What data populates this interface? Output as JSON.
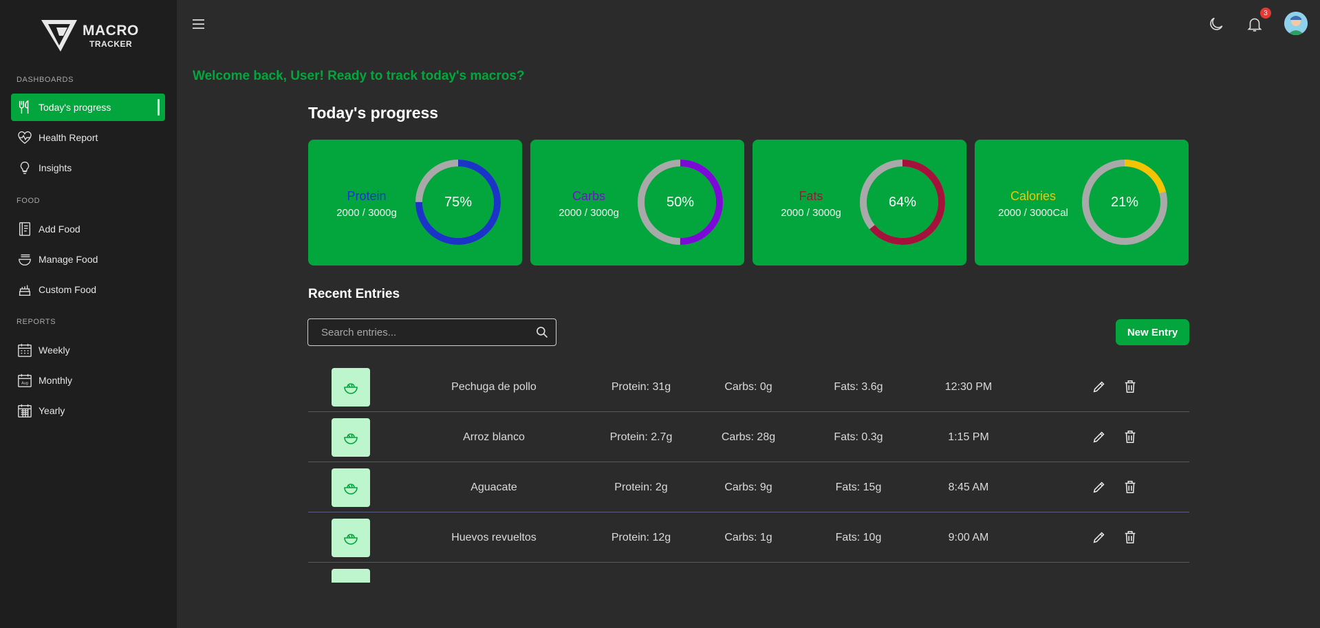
{
  "app": {
    "logo_line1": "MACRO",
    "logo_line2": "TRACKER"
  },
  "sidebar": {
    "sections": [
      {
        "title": "DASHBOARDS"
      },
      {
        "title": "FOOD"
      },
      {
        "title": "REPORTS"
      }
    ],
    "items": [
      {
        "label": "Today's progress",
        "icon": "utensils-icon",
        "active": true
      },
      {
        "label": "Health Report",
        "icon": "heart-pulse-icon"
      },
      {
        "label": "Insights",
        "icon": "lightbulb-icon"
      },
      {
        "label": "Add Food",
        "icon": "notebook-icon"
      },
      {
        "label": "Manage Food",
        "icon": "bowl-icon"
      },
      {
        "label": "Custom Food",
        "icon": "cake-icon"
      },
      {
        "label": "Weekly",
        "icon": "calendar-week-icon"
      },
      {
        "label": "Monthly",
        "icon": "calendar-month-icon"
      },
      {
        "label": "Yearly",
        "icon": "calendar-year-icon"
      }
    ]
  },
  "topbar": {
    "notification_count": "3",
    "icons": [
      "menu-icon",
      "moon-icon",
      "bell-icon",
      "avatar"
    ]
  },
  "welcome": "Welcome back, User! Ready to track today's macros?",
  "progress": {
    "title": "Today's progress",
    "cards": [
      {
        "label": "Protein",
        "amount": "2000 / 3000g",
        "percent_text": "75%",
        "percent": 75,
        "color": "#1b34c8"
      },
      {
        "label": "Carbs",
        "amount": "2000 / 3000g",
        "percent_text": "50%",
        "percent": 50,
        "color": "#7b0ad6"
      },
      {
        "label": "Fats",
        "amount": "2000 / 3000g",
        "percent_text": "64%",
        "percent": 64,
        "color": "#a4113b"
      },
      {
        "label": "Calories",
        "amount": "2000 / 3000Cal",
        "percent_text": "21%",
        "percent": 21,
        "color": "#f5c400"
      }
    ],
    "track_color": "#a9a9a9",
    "card_color": "#03a63c"
  },
  "recent": {
    "title": "Recent Entries",
    "search_placeholder": "Search entries...",
    "new_entry_label": "New Entry",
    "entries": [
      {
        "name": "Pechuga de pollo",
        "protein": "Protein: 31g",
        "carbs": "Carbs: 0g",
        "fats": "Fats: 3.6g",
        "time": "12:30 PM"
      },
      {
        "name": "Arroz blanco",
        "protein": "Protein: 2.7g",
        "carbs": "Carbs: 28g",
        "fats": "Fats: 0.3g",
        "time": "1:15 PM"
      },
      {
        "name": "Aguacate",
        "protein": "Protein: 2g",
        "carbs": "Carbs: 9g",
        "fats": "Fats: 15g",
        "time": "8:45 AM"
      },
      {
        "name": "Huevos revueltos",
        "protein": "Protein: 12g",
        "carbs": "Carbs: 1g",
        "fats": "Fats: 10g",
        "time": "9:00 AM"
      }
    ]
  }
}
